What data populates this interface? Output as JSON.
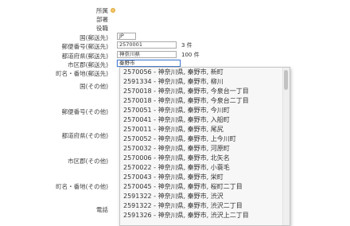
{
  "form": {
    "labels": {
      "shozoku": "所属",
      "busho": "部署",
      "yakushoku": "役職",
      "kuni": "国(郵送先)",
      "yubin": "郵便番号(郵送先)",
      "todofuken": "都道府県(郵送先)",
      "shikuchoson": "市区郡(郵送先)",
      "chomei": "町名・番地(郵送先)",
      "kuni_other": "国(その他)",
      "yubin_other": "郵便番号(その他)",
      "todofuken_other": "都道府県(その他)",
      "shiku_other": "市区郡(その他)",
      "chomei_other": "町名・番地(その他)",
      "denwa": "電話"
    },
    "values": {
      "kuni": "JP",
      "yubin": "2570001",
      "todofuken": "神奈川県",
      "shikuchoson": "秦野市"
    },
    "counts": {
      "yubin": "3 件",
      "todofuken": "100 件"
    }
  },
  "autocomplete": {
    "items": [
      "2570056 - 神奈川県, 秦野市, 新町",
      "2591334 - 神奈川県, 秦野市, 柳川",
      "2570018 - 神奈川県, 秦野市, 今泉台一丁目",
      "2570018 - 神奈川県, 秦野市, 今泉台二丁目",
      "2570051 - 神奈川県, 秦野市, 今川町",
      "2570041 - 神奈川県, 秦野市, 入船町",
      "2570011 - 神奈川県, 秦野市, 尾尻",
      "2570052 - 神奈川県, 秦野市, 上今川町",
      "2570032 - 神奈川県, 秦野市, 河原町",
      "2570006 - 神奈川県, 秦野市, 北矢名",
      "2570022 - 神奈川県, 秦野市, 小蓑毛",
      "2570043 - 神奈川県, 秦野市, 栄町",
      "2570045 - 神奈川県, 秦野市, 桜町二丁目",
      "2591322 - 神奈川県, 秦野市, 渋沢",
      "2591322 - 神奈川県, 秦野市, 渋沢二丁目",
      "2591326 - 神奈川県, 秦野市, 渋沢上二丁目"
    ]
  }
}
